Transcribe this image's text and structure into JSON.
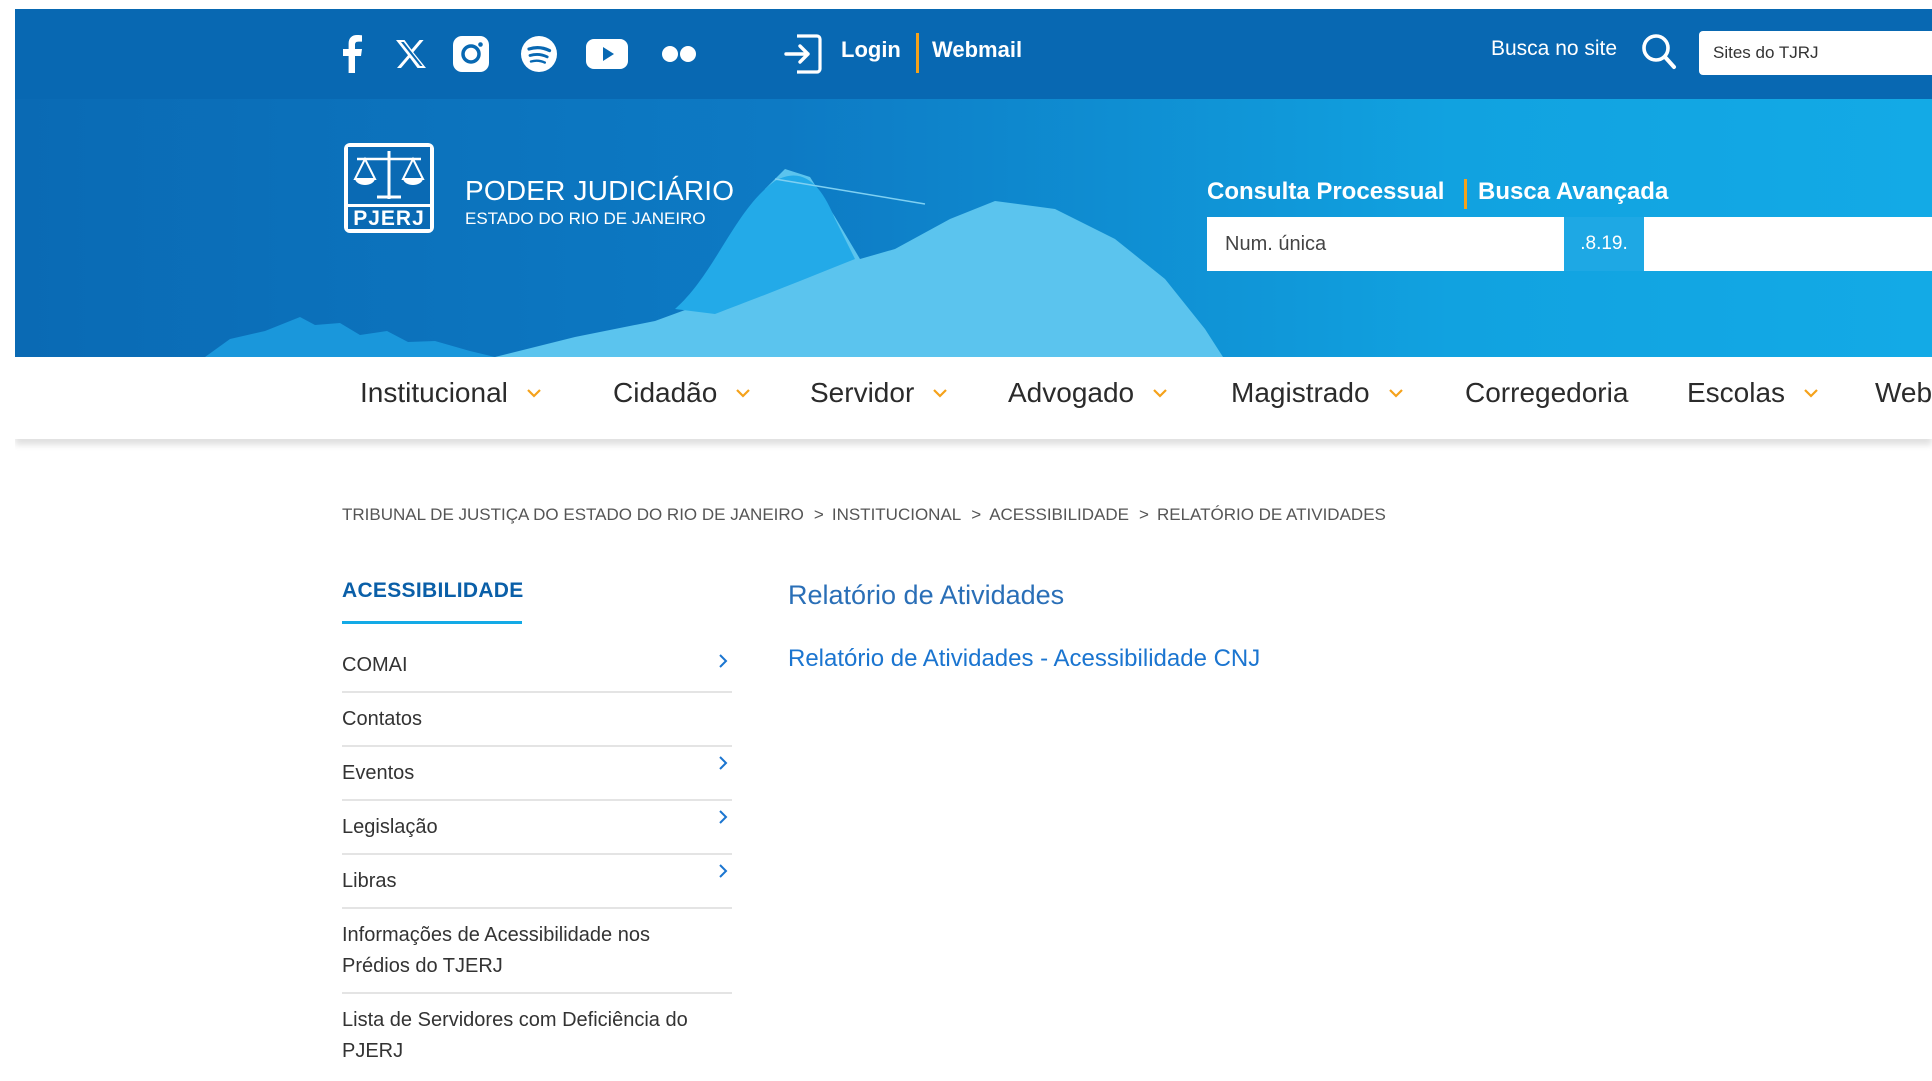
{
  "topbar": {
    "social_icons": [
      "facebook-icon",
      "x-twitter-icon",
      "instagram-icon",
      "spotify-icon",
      "youtube-icon",
      "flickr-icon"
    ],
    "login_label": "Login",
    "webmail_label": "Webmail",
    "search_label": "Busca no site",
    "sites_placeholder": "Sites do TJRJ"
  },
  "banner": {
    "org_name": "PODER JUDICIÁRIO",
    "org_subtitle": "ESTADO DO RIO DE JANEIRO",
    "logo_text": "PJERJ",
    "consulta_label": "Consulta Processual",
    "busca_avancada_label": "Busca Avançada",
    "num_placeholder": "Num. única",
    "code": ".8.19."
  },
  "nav": {
    "items": [
      {
        "label": "Institucional",
        "dropdown": true
      },
      {
        "label": "Cidadão",
        "dropdown": true
      },
      {
        "label": "Servidor",
        "dropdown": true
      },
      {
        "label": "Advogado",
        "dropdown": true
      },
      {
        "label": "Magistrado",
        "dropdown": true
      },
      {
        "label": "Corregedoria",
        "dropdown": false
      },
      {
        "label": "Escolas",
        "dropdown": true
      },
      {
        "label": "Web",
        "dropdown": false
      }
    ]
  },
  "breadcrumb": [
    "TRIBUNAL DE JUSTIÇA DO ESTADO DO RIO DE JANEIRO",
    "INSTITUCIONAL",
    "ACESSIBILIDADE",
    "RELATÓRIO DE ATIVIDADES"
  ],
  "sidebar": {
    "title": "ACESSIBILIDADE",
    "items": [
      {
        "label": "COMAI",
        "has_submenu": true
      },
      {
        "label": "Contatos",
        "has_submenu": false
      },
      {
        "label": "Eventos",
        "has_submenu": true
      },
      {
        "label": "Legislação",
        "has_submenu": true
      },
      {
        "label": "Libras",
        "has_submenu": true
      },
      {
        "label": "Informações de Acessibilidade nos Prédios do TJERJ",
        "has_submenu": false
      },
      {
        "label": "Lista de Servidores com Deficiência do PJERJ",
        "has_submenu": false
      }
    ]
  },
  "main": {
    "title": "Relatório de Atividades",
    "links": [
      "Relatório de Atividades - Acessibilidade CNJ"
    ]
  },
  "colors": {
    "topbar": "#0868b2",
    "accent": "#f5a21b",
    "link": "#1b75d0",
    "banner_light": "#13aae6"
  }
}
